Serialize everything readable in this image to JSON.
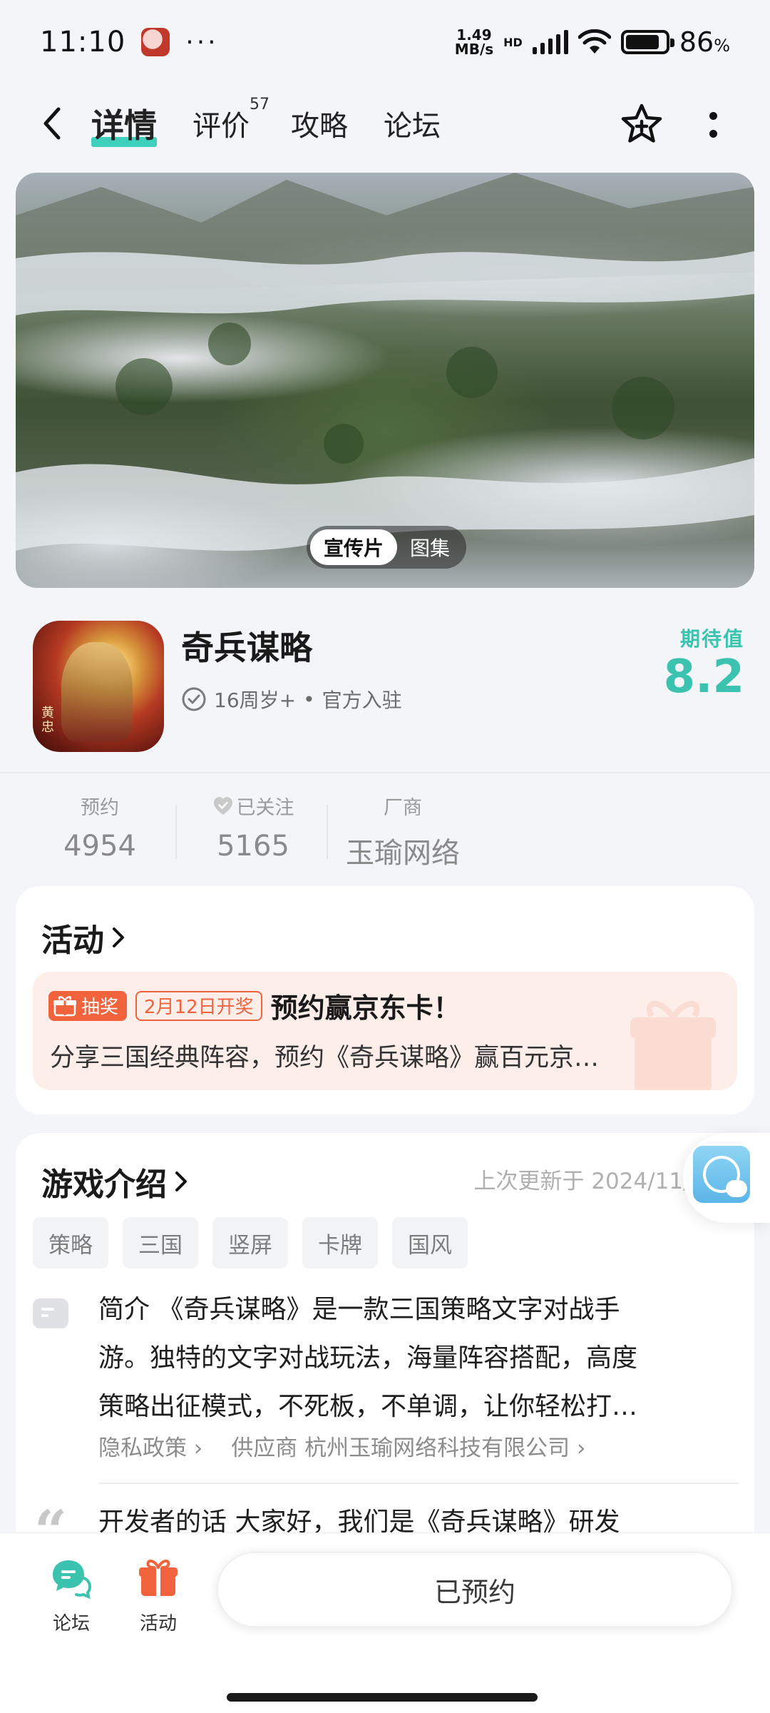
{
  "status_bar": {
    "time": "11:10",
    "dots": "···",
    "net_speed_value": "1.49",
    "net_speed_unit": "MB/s",
    "hd_label": "HD",
    "battery_percent": "86",
    "battery_symbol": "%",
    "battery_level": 0.86
  },
  "nav": {
    "tabs": [
      {
        "label": "详情",
        "active": true
      },
      {
        "label": "评价",
        "badge": "57"
      },
      {
        "label": "攻略"
      },
      {
        "label": "论坛"
      }
    ]
  },
  "media": {
    "trailer_label": "宣传片",
    "gallery_label": "图集"
  },
  "game": {
    "name": "奇兵谋略",
    "icon_seal": "黄忠",
    "age_rating": "16周岁+",
    "meta_sep": "•",
    "official_label": "官方入驻",
    "expect_label": "期待值",
    "expect_value": "8.2"
  },
  "stats": [
    {
      "label": "预约",
      "value": "4954"
    },
    {
      "label": "已关注",
      "value": "5165"
    },
    {
      "label": "厂商",
      "value": "玉瑜网络"
    }
  ],
  "activity": {
    "title": "活动",
    "lottery_tag": "抽奖",
    "date_tag": "2月12日开奖",
    "event_title": "预约赢京东卡！",
    "event_desc": "分享三国经典阵容，预约《奇兵谋略》赢百元京…"
  },
  "intro": {
    "title": "游戏介绍",
    "update_time": "上次更新于 2024/11/29",
    "tags": [
      "策略",
      "三国",
      "竖屏",
      "卡牌",
      "国风"
    ],
    "lead": "简介",
    "lines": [
      "《奇兵谋略》是一款三国策略文字对战手",
      "游。独特的文字对战玩法，海量阵容搭配，高度",
      "策略出征模式，不死板，不单调，让你轻松打…"
    ],
    "privacy_label": "隐私政策",
    "supplier_label": "供应商 杭州玉瑜网络科技有限公司",
    "dev_lead": "开发者的话",
    "dev_text": "大家好，我们是《奇兵谋略》研发"
  },
  "bottom": {
    "forum_label": "论坛",
    "activity_label": "活动",
    "reserve_label": "已预约"
  },
  "colors": {
    "accent_teal": "#3cc3b0",
    "tab_underline": "#3fd0bd",
    "event_orange": "#f0633d",
    "event_bg": "#fdeee9"
  }
}
